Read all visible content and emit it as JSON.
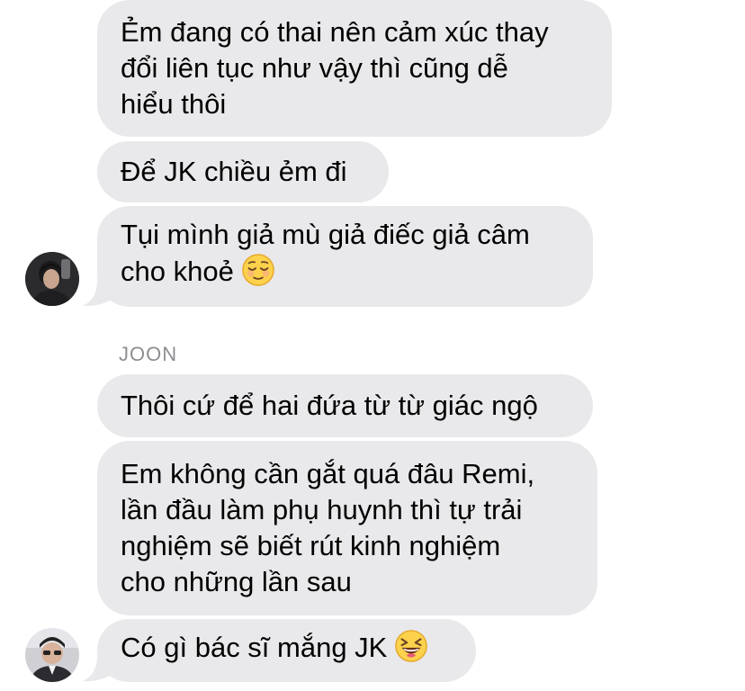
{
  "colors": {
    "bubble_background": "#e9e9eb",
    "text": "#000000",
    "sender_name": "#8e8e93",
    "background": "#ffffff"
  },
  "group_1": {
    "messages": [
      {
        "text": "Ẻm đang có thai nên cảm xúc thay\nđổi liên tục như vậy thì cũng dễ\nhiểu thôi"
      },
      {
        "text": "Để JK chiều ẻm đi"
      },
      {
        "text": "Tụi mình giả mù giả điếc giả câm\ncho khoẻ",
        "emoji": "relieved-face-icon"
      }
    ],
    "avatar": "avatar-photo"
  },
  "group_2": {
    "sender": "JOON",
    "messages": [
      {
        "text": "Thôi cứ để hai đứa từ từ giác ngộ"
      },
      {
        "text": "Em không cần gắt quá đâu Remi,\nlần đầu làm phụ huynh thì tự trải\nnghiệm sẽ biết rút kinh nghiệm\ncho những lần sau"
      },
      {
        "text": "Có gì bác sĩ mắng JK",
        "emoji": "laughing-squinting-face-icon"
      }
    ],
    "avatar": "avatar-photo"
  }
}
